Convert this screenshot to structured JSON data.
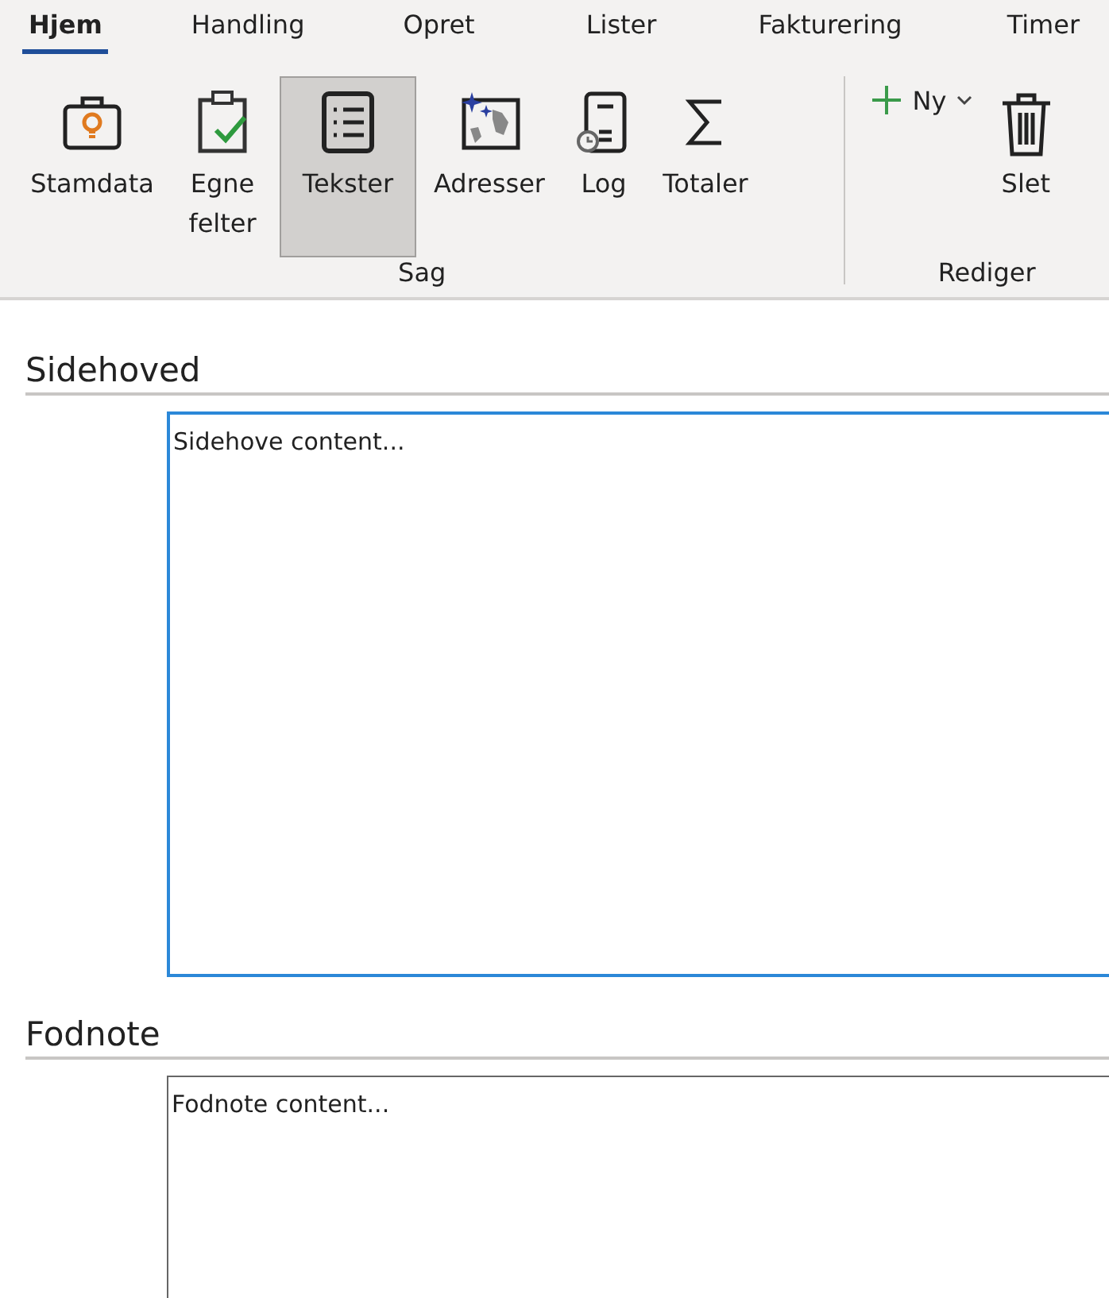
{
  "tabs": [
    {
      "label": "Hjem",
      "selected": true
    },
    {
      "label": "Handling",
      "selected": false
    },
    {
      "label": "Opret",
      "selected": false
    },
    {
      "label": "Lister",
      "selected": false
    },
    {
      "label": "Fakturering",
      "selected": false
    },
    {
      "label": "Timer",
      "selected": false
    }
  ],
  "groups": [
    {
      "label": "Sag",
      "buttons": [
        {
          "kind": "briefcase",
          "label": "Stamdata",
          "selected": false
        },
        {
          "kind": "clipboard",
          "label": "Egne felter",
          "selected": false
        },
        {
          "kind": "list",
          "label": "Tekster",
          "selected": true
        },
        {
          "kind": "map",
          "label": "Adresser",
          "selected": false
        },
        {
          "kind": "log",
          "label": "Log",
          "selected": false
        },
        {
          "kind": "sigma",
          "label": "Totaler",
          "selected": false
        }
      ]
    },
    {
      "label": "Rediger",
      "buttons": [
        {
          "kind": "new",
          "label": "Ny",
          "selected": false
        },
        {
          "kind": "trash",
          "label": "Slet",
          "selected": false
        }
      ]
    }
  ],
  "sections": [
    {
      "title": "Sidehoved",
      "value": "Sidehove content...",
      "focused": true
    },
    {
      "title": "Fodnote",
      "value": "Fodnote content...",
      "focused": false
    }
  ]
}
